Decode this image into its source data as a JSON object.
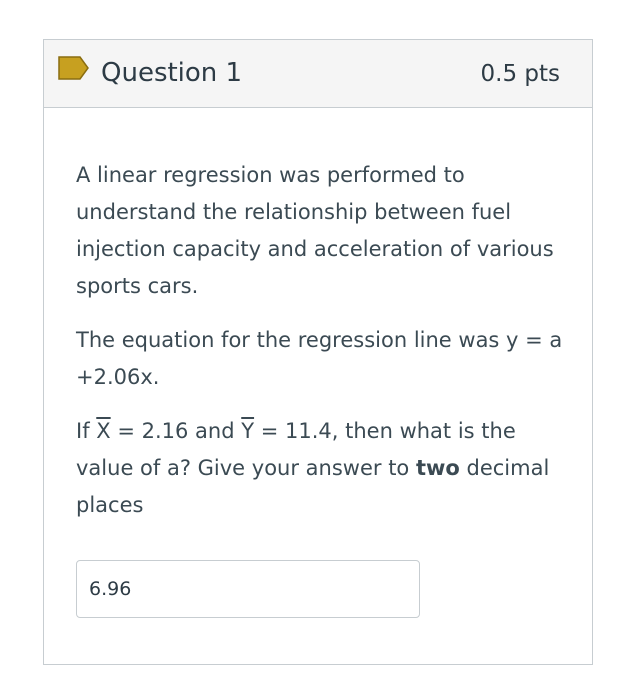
{
  "question": {
    "title": "Question 1",
    "points": "0.5 pts",
    "flag_color": "#c7a020",
    "paragraphs": {
      "p1": "A linear regression was performed to understand the relationship between fuel injection capacity and acceleration of various sports cars.",
      "p2": "The equation for the regression line was y = a +2.06x.",
      "p3_if": "If ",
      "p3_xbar": "X",
      "p3_mid1": " = 2.16 and ",
      "p3_ybar": "Y",
      "p3_mid2": " = 11.4, then what is the value of a?  Give your answer to ",
      "p3_bold": "two",
      "p3_end": " decimal places"
    },
    "answer_value": "6.96"
  }
}
